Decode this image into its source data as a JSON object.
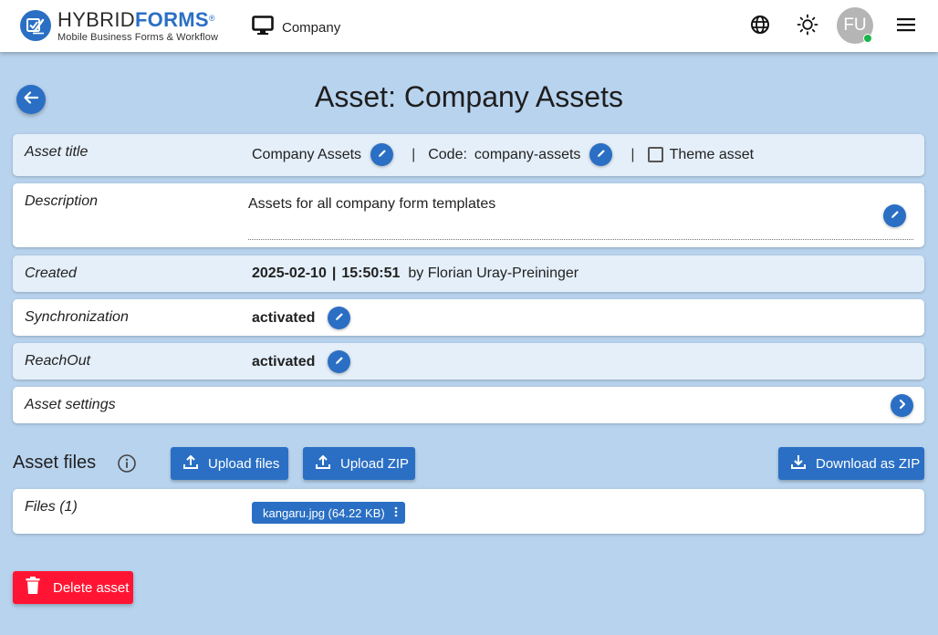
{
  "header": {
    "logo": {
      "brand_light": "HYBRID",
      "brand_bold": "FORMS",
      "registered": "®",
      "tagline": "Mobile Business Forms & Workflow"
    },
    "company_label": "Company",
    "avatar_initials": "FU",
    "icons": [
      "globe-icon",
      "sun-icon",
      "hamburger-menu-icon"
    ]
  },
  "page": {
    "title": "Asset: Company Assets"
  },
  "rows": {
    "asset_title": {
      "label": "Asset title",
      "value": "Company Assets",
      "code_label": "Code:",
      "code_value": "company-assets",
      "separator": "|",
      "theme_asset_label": "Theme asset",
      "theme_asset_checked": false
    },
    "description": {
      "label": "Description",
      "value": "Assets for all company form templates"
    },
    "created": {
      "label": "Created",
      "date": "2025-02-10",
      "separator": "|",
      "time": "15:50:51",
      "by": "by Florian Uray-Preininger"
    },
    "synchronization": {
      "label": "Synchronization",
      "value": "activated"
    },
    "reachout": {
      "label": "ReachOut",
      "value": "activated"
    },
    "asset_settings": {
      "label": "Asset settings"
    }
  },
  "asset_files": {
    "title": "Asset files",
    "upload_files_label": "Upload files",
    "upload_zip_label": "Upload ZIP",
    "download_zip_label": "Download as ZIP",
    "files_label": "Files (1)",
    "files": [
      {
        "name": "kangaru.jpg (64.22 KB)"
      }
    ]
  },
  "actions": {
    "delete_label": "Delete asset"
  },
  "colors": {
    "primary": "#2a6fc4",
    "danger": "#ff1533",
    "background": "#b8d3ee",
    "row_alt": "#e4eff9",
    "status_online": "#18b548"
  }
}
